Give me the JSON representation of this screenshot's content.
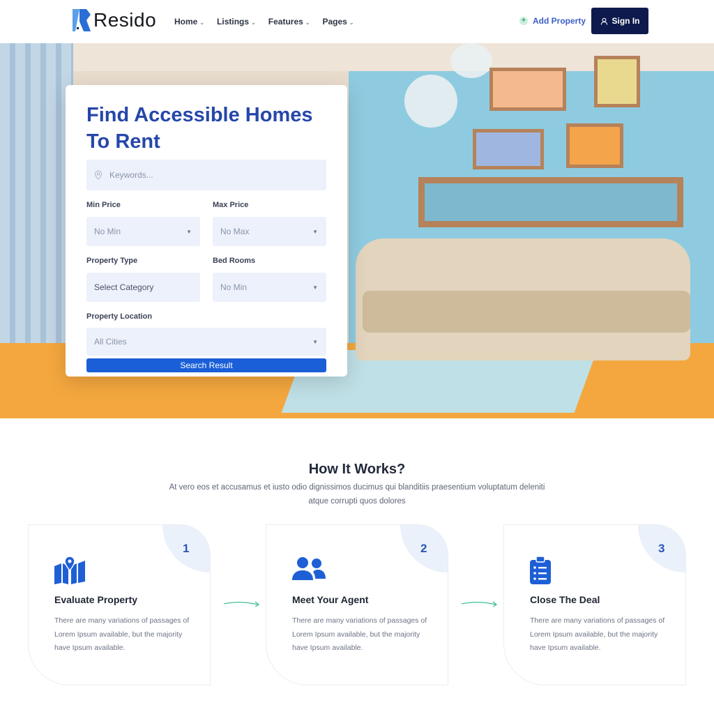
{
  "header": {
    "logo": "Resido",
    "nav": [
      {
        "label": "Home"
      },
      {
        "label": "Listings"
      },
      {
        "label": "Features"
      },
      {
        "label": "Pages"
      }
    ],
    "add_property": "Add Property",
    "sign_in": "Sign In"
  },
  "search": {
    "title": "Find Accessible Homes To Rent",
    "keywords_placeholder": "Keywords...",
    "min_price_label": "Min Price",
    "min_price_value": "No Min",
    "max_price_label": "Max Price",
    "max_price_value": "No Max",
    "property_type_label": "Property Type",
    "property_type_value": "Select Category",
    "bed_rooms_label": "Bed Rooms",
    "bed_rooms_value": "No Min",
    "location_label": "Property Location",
    "location_value": "All Cities",
    "search_button": "Search Result"
  },
  "how_it_works": {
    "title": "How It Works?",
    "subtitle": "At vero eos et accusamus et iusto odio dignissimos ducimus qui blanditiis praesentium voluptatum deleniti atque corrupti quos dolores",
    "steps": [
      {
        "number": "1",
        "icon": "map-pin-icon",
        "title": "Evaluate Property",
        "text": "There are many variations of passages of Lorem Ipsum available, but the majority have Ipsum available."
      },
      {
        "number": "2",
        "icon": "users-icon",
        "title": "Meet Your Agent",
        "text": "There are many variations of passages of Lorem Ipsum available, but the majority have Ipsum available."
      },
      {
        "number": "3",
        "icon": "clipboard-list-icon",
        "title": "Close The Deal",
        "text": "There are many variations of passages of Lorem Ipsum available, but the majority have Ipsum available."
      }
    ]
  },
  "colors": {
    "primary": "#2647a9",
    "button": "#1a5fd8",
    "dark": "#0e1a4d",
    "arrow": "#3fbf9a"
  }
}
